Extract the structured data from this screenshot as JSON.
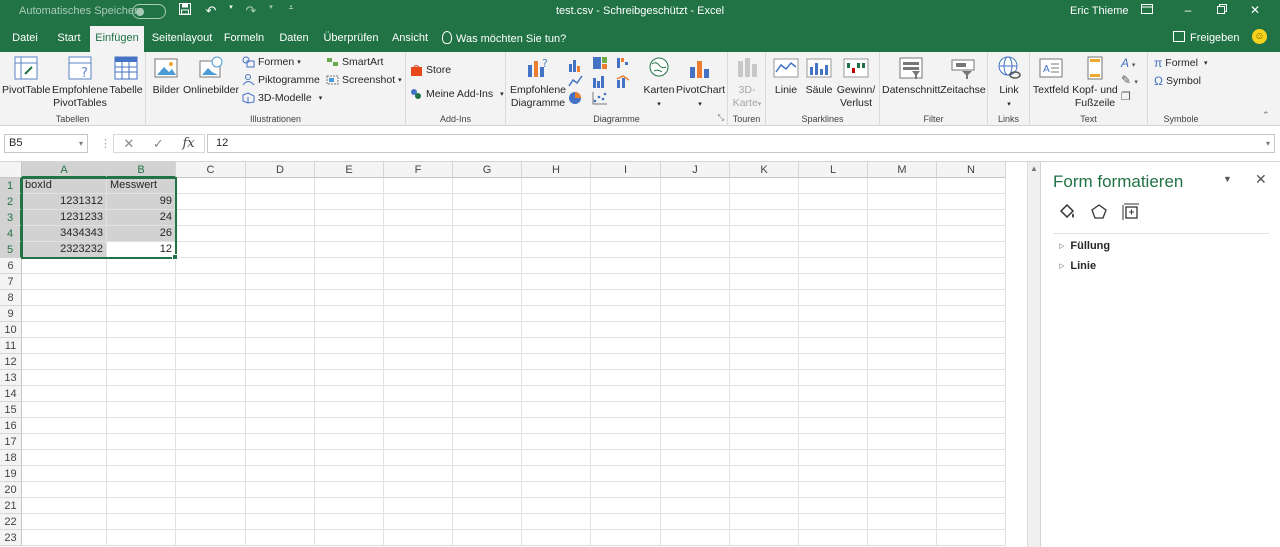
{
  "titlebar": {
    "autosave_label": "Automatisches Speichern",
    "title": "test.csv  -  Schreibgeschützt  -  Excel",
    "user": "Eric Thieme",
    "save_icon": "save-icon",
    "undo_icon": "undo-icon",
    "redo_icon": "redo-icon"
  },
  "tabs": [
    {
      "label": "Datei"
    },
    {
      "label": "Start"
    },
    {
      "label": "Einfügen"
    },
    {
      "label": "Seitenlayout"
    },
    {
      "label": "Formeln"
    },
    {
      "label": "Daten"
    },
    {
      "label": "Überprüfen"
    },
    {
      "label": "Ansicht"
    }
  ],
  "tellme": "Was möchten Sie tun?",
  "share": "Freigeben",
  "ribbon": {
    "tabellen": {
      "label": "Tabellen",
      "pivottable": "PivotTable",
      "empfohlene_line1": "Empfohlene",
      "empfohlene_line2": "PivotTables",
      "tabelle": "Tabelle"
    },
    "illustrationen": {
      "label": "Illustrationen",
      "bilder": "Bilder",
      "onlinebilder": "Onlinebilder",
      "formen": "Formen",
      "piktogramme": "Piktogramme",
      "modelle": "3D-Modelle",
      "smartart": "SmartArt",
      "screenshot": "Screenshot"
    },
    "addins": {
      "label": "Add-Ins",
      "store": "Store",
      "meine": "Meine Add-Ins"
    },
    "diagramme": {
      "label": "Diagramme",
      "empfohlene_line1": "Empfohlene",
      "empfohlene_line2": "Diagramme",
      "karten": "Karten",
      "pivotchart": "PivotChart"
    },
    "touren": {
      "label": "Touren",
      "karte_line1": "3D-",
      "karte_line2": "Karte"
    },
    "sparklines": {
      "label": "Sparklines",
      "linie": "Linie",
      "saeule": "Säule",
      "gewinn_line1": "Gewinn/",
      "gewinn_line2": "Verlust"
    },
    "filter": {
      "label": "Filter",
      "datenschnitt": "Datenschnitt",
      "zeitachse": "Zeitachse"
    },
    "links": {
      "label": "Links",
      "link": "Link"
    },
    "text": {
      "label": "Text",
      "textfeld": "Textfeld",
      "kopf_line1": "Kopf- und",
      "kopf_line2": "Fußzeile"
    },
    "symbole": {
      "label": "Symbole",
      "formel": "Formel",
      "symbol": "Symbol"
    }
  },
  "formulabar": {
    "namebox": "B5",
    "value": "12",
    "fx": "fx"
  },
  "columns": [
    "A",
    "B",
    "C",
    "D",
    "E",
    "F",
    "G",
    "H",
    "I",
    "J",
    "K",
    "L",
    "M",
    "N"
  ],
  "rows": [
    "1",
    "2",
    "3",
    "4",
    "5",
    "6",
    "7",
    "8",
    "9",
    "10",
    "11",
    "12",
    "13",
    "14",
    "15",
    "16",
    "17",
    "18",
    "19",
    "20",
    "21",
    "22",
    "23"
  ],
  "cells": {
    "A1": "boxId",
    "B1": "Messwert",
    "A2": "1231312",
    "B2": "99",
    "A3": "1231233",
    "B3": "24",
    "A4": "3434343",
    "B4": "26",
    "A5": "2323232",
    "B5": "12"
  },
  "pane": {
    "title": "Form formatieren",
    "fill": "Füllung",
    "line": "Linie"
  },
  "colors": {
    "accent": "#217346",
    "selection": "#d2d2d2"
  }
}
